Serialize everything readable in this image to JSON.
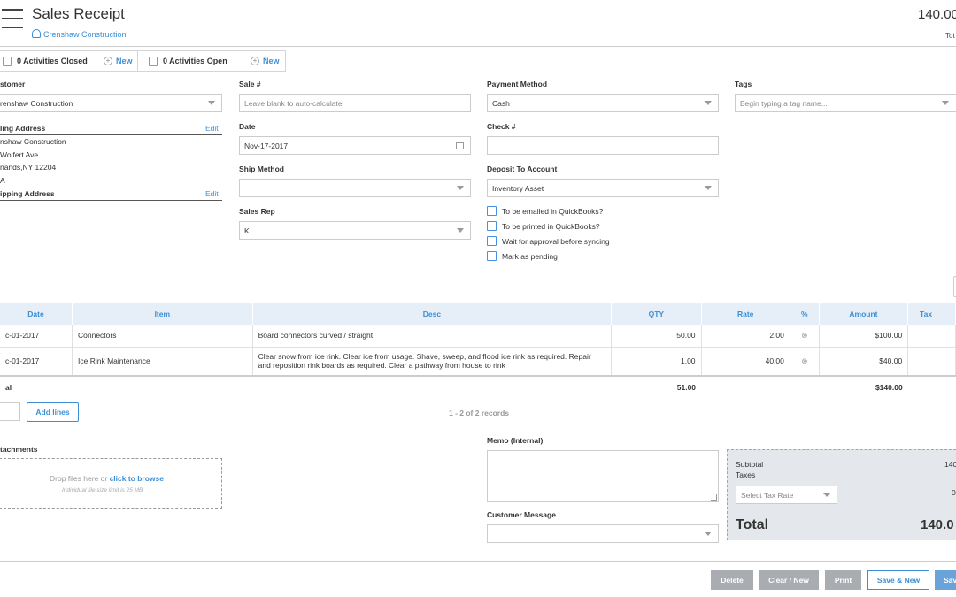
{
  "header": {
    "title": "Sales Receipt",
    "customer_link": "Crenshaw  Construction",
    "total_amount": "140.00",
    "total_label": "Tot"
  },
  "activities": {
    "closed_label": "0 Activities Closed",
    "closed_new": "New",
    "open_label": "0 Activities Open",
    "open_new": "New"
  },
  "customer": {
    "label": "stomer",
    "value": "renshaw Construction",
    "billing_label": "ling Address",
    "billing_edit": "Edit",
    "billing_lines": [
      "nshaw Construction",
      "Wolfert Ave",
      "nands,NY 12204",
      "A"
    ],
    "shipping_label": "ipping Address",
    "shipping_edit": "Edit"
  },
  "sale": {
    "sale_no_label": "Sale #",
    "sale_no_placeholder": "Leave blank to auto-calculate",
    "date_label": "Date",
    "date_value": "Nov-17-2017",
    "ship_method_label": "Ship Method",
    "ship_method_value": "",
    "sales_rep_label": "Sales Rep",
    "sales_rep_value": "K"
  },
  "payment": {
    "method_label": "Payment Method",
    "method_value": "Cash",
    "check_label": "Check #",
    "check_value": "",
    "deposit_label": "Deposit To Account",
    "deposit_value": "Inventory Asset",
    "checkboxes": [
      {
        "label": "To be emailed in QuickBooks?",
        "checked": false
      },
      {
        "label": "To be printed in QuickBooks?",
        "checked": false
      },
      {
        "label": "Wait for approval before syncing",
        "checked": false
      },
      {
        "label": "Mark as pending",
        "checked": false
      }
    ]
  },
  "tags": {
    "label": "Tags",
    "placeholder": "Begin typing a tag name..."
  },
  "table": {
    "headers": [
      "Date",
      "Item",
      "Desc",
      "QTY",
      "Rate",
      "%",
      "Amount",
      "Tax"
    ],
    "rows": [
      {
        "date": "c-01-2017",
        "item": "Connectors",
        "desc": "Board connectors curved / straight",
        "qty": "50.00",
        "rate": "2.00",
        "amount": "$100.00"
      },
      {
        "date": "c-01-2017",
        "item": "Ice Rink Maintenance",
        "desc": "Clear snow from ice rink. Clear ice from usage. Shave, sweep, and flood ice rink as required. Repair and reposition rink boards as required. Clear a pathway from house to rink",
        "qty": "1.00",
        "rate": "40.00",
        "amount": "$40.00"
      }
    ],
    "total_label": "al",
    "total_qty": "51.00",
    "total_amount": "$140.00",
    "add_lines": "Add lines",
    "records": "1 - 2 of 2 records"
  },
  "attachments": {
    "label": "tachments",
    "drop_text": "Drop files here or ",
    "browse_text": "click to browse",
    "limit_text": "Individual file size limit is 25 MB"
  },
  "memo": {
    "label": "Memo (Internal)",
    "customer_message_label": "Customer Message"
  },
  "summary": {
    "subtotal_label": "Subtotal",
    "subtotal_value": "140.",
    "taxes_label": "Taxes",
    "tax_rate_placeholder": "Select Tax Rate",
    "tax_value": "0",
    "total_label": "Total",
    "total_value": "140.0"
  },
  "footer": {
    "delete": "Delete",
    "clear_new": "Clear / New",
    "print": "Print",
    "save_new": "Save & New",
    "save": "Sav"
  }
}
